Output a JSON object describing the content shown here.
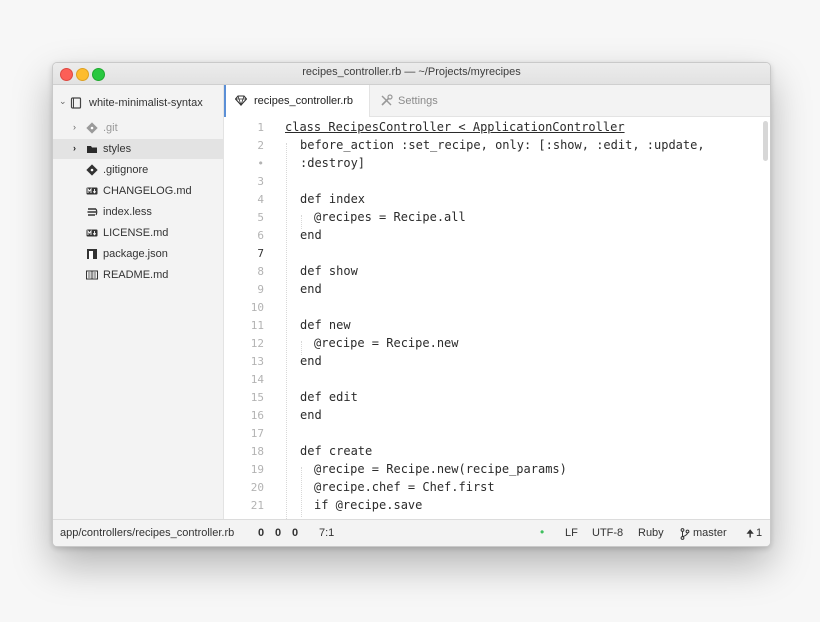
{
  "window": {
    "title": "recipes_controller.rb — ~/Projects/myrecipes"
  },
  "sidebar": {
    "root": "white-minimalist-syntax",
    "items": [
      {
        "label": ".git",
        "icon": "git-repo-icon",
        "expandable": true
      },
      {
        "label": "styles",
        "icon": "folder-icon",
        "expandable": true,
        "selected": true
      },
      {
        "label": ".gitignore",
        "icon": "git-icon",
        "expandable": false
      },
      {
        "label": "CHANGELOG.md",
        "icon": "markdown-icon",
        "expandable": false
      },
      {
        "label": "index.less",
        "icon": "less-icon",
        "expandable": false
      },
      {
        "label": "LICENSE.md",
        "icon": "markdown-icon",
        "expandable": false
      },
      {
        "label": "package.json",
        "icon": "package-icon",
        "expandable": false
      },
      {
        "label": "README.md",
        "icon": "book-icon",
        "expandable": false
      }
    ]
  },
  "tabs": [
    {
      "label": "recipes_controller.rb",
      "icon": "ruby-icon",
      "active": true
    },
    {
      "label": "Settings",
      "icon": "tools-icon",
      "active": false
    }
  ],
  "editor": {
    "current_line": 7,
    "lines": [
      {
        "n": "1",
        "text": "class RecipesController < ApplicationController"
      },
      {
        "n": "2",
        "text": "before_action :set_recipe, only: [:show, :edit, :update,"
      },
      {
        "n": "•",
        "text": ":destroy]"
      },
      {
        "n": "3",
        "text": ""
      },
      {
        "n": "4",
        "text": "def index"
      },
      {
        "n": "5",
        "text": "@recipes = Recipe.all"
      },
      {
        "n": "6",
        "text": "end"
      },
      {
        "n": "7",
        "text": ""
      },
      {
        "n": "8",
        "text": "def show"
      },
      {
        "n": "9",
        "text": "end"
      },
      {
        "n": "10",
        "text": ""
      },
      {
        "n": "11",
        "text": "def new"
      },
      {
        "n": "12",
        "text": "@recipe = Recipe.new"
      },
      {
        "n": "13",
        "text": "end"
      },
      {
        "n": "14",
        "text": ""
      },
      {
        "n": "15",
        "text": "def edit"
      },
      {
        "n": "16",
        "text": "end"
      },
      {
        "n": "17",
        "text": ""
      },
      {
        "n": "18",
        "text": "def create"
      },
      {
        "n": "19",
        "text": "@recipe = Recipe.new(recipe_params)"
      },
      {
        "n": "20",
        "text": "@recipe.chef = Chef.first"
      },
      {
        "n": "21",
        "text": "if @recipe.save"
      }
    ]
  },
  "statusbar": {
    "file_path": "app/controllers/recipes_controller.rb",
    "lint_counts": [
      "0",
      "0",
      "0"
    ],
    "cursor": "7:1",
    "line_ending": "LF",
    "encoding": "UTF-8",
    "grammar": "Ruby",
    "branch": "master",
    "push_count": "1",
    "dot_color": "#3fbf5e"
  }
}
